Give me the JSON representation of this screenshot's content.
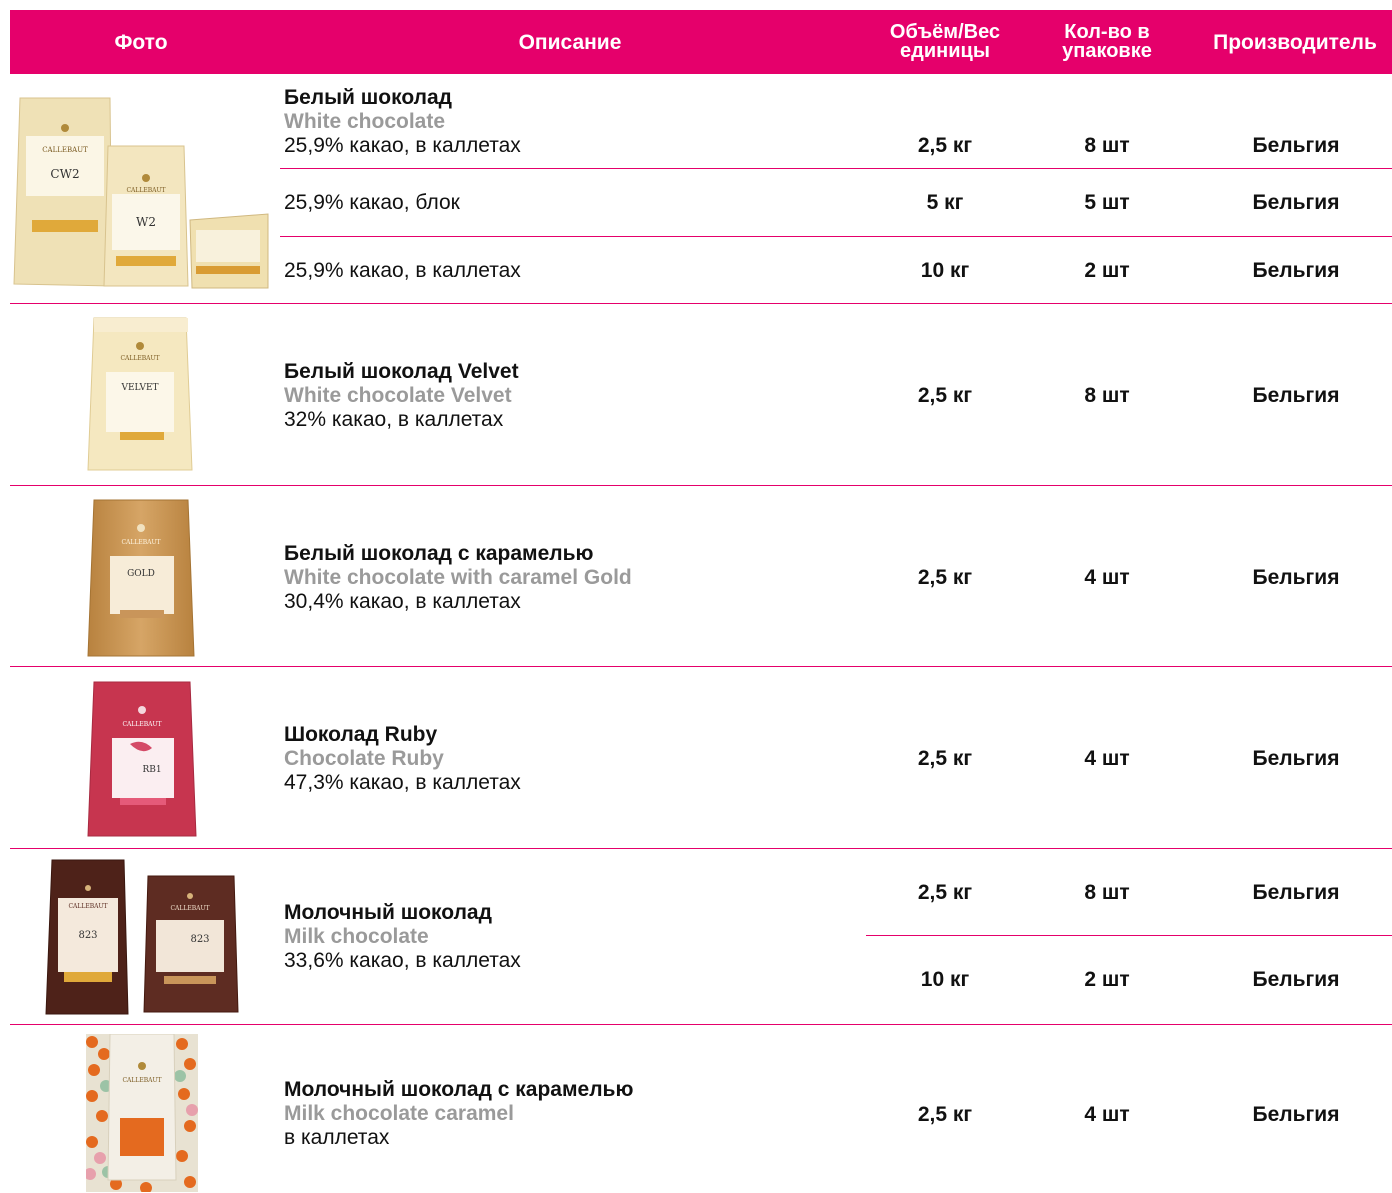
{
  "header": {
    "photo": "Фото",
    "description": "Описание",
    "weight": "Объём/Вес\nединицы",
    "qty": "Кол-во в\nупаковке",
    "maker": "Производитель"
  },
  "brand_on_packages": "CALLEBAUT",
  "products": [
    {
      "title": "Белый шоколад",
      "title_en": "White chocolate",
      "variants": [
        {
          "desc": "25,9% какао, в каллетах",
          "weight": "2,5 кг",
          "qty": "8 шт",
          "maker": "Бельгия"
        },
        {
          "desc": "25,9% какао, блок",
          "weight": "5 кг",
          "qty": "5 шт",
          "maker": "Бельгия"
        },
        {
          "desc": "25,9% какао, в каллетах",
          "weight": "10 кг",
          "qty": "2 шт",
          "maker": "Бельгия"
        }
      ],
      "package_labels": [
        "CW2",
        "W2"
      ],
      "package_color": "#f1e3b8"
    },
    {
      "title": "Белый шоколад Velvet",
      "title_en": "White chocolate Velvet",
      "desc": "32% какао, в каллетах",
      "weight": "2,5 кг",
      "qty": "8 шт",
      "maker": "Бельгия",
      "package_labels": [
        "VELVET"
      ],
      "package_color": "#f5e8c0"
    },
    {
      "title": "Белый шоколад с карамелью",
      "title_en": "White chocolate with caramel Gold",
      "desc": "30,4% какао, в каллетах",
      "weight": "2,5 кг",
      "qty": "4 шт",
      "maker": "Бельгия",
      "package_labels": [
        "GOLD"
      ],
      "package_color": "#c9955a"
    },
    {
      "title": "Шоколад Ruby",
      "title_en": "Chocolate Ruby",
      "desc": "47,3% какао, в каллетах",
      "weight": "2,5 кг",
      "qty": "4 шт",
      "maker": "Бельгия",
      "package_labels": [
        "RB1"
      ],
      "package_color": "#c7354f"
    },
    {
      "title": "Молочный шоколад",
      "title_en": "Milk chocolate",
      "desc": "33,6% какао, в каллетах",
      "variants": [
        {
          "weight": "2,5 кг",
          "qty": "8 шт",
          "maker": "Бельгия"
        },
        {
          "weight": "10 кг",
          "qty": "2 шт",
          "maker": "Бельгия"
        }
      ],
      "package_labels": [
        "823",
        "823"
      ],
      "package_color": "#5a2b20"
    },
    {
      "title": "Молочный шоколад с карамелью",
      "title_en": "Milk chocolate caramel",
      "desc": "в каллетах",
      "weight": "2,5 кг",
      "qty": "4 шт",
      "maker": "Бельгия",
      "package_color": "#f3efe6"
    }
  ]
}
